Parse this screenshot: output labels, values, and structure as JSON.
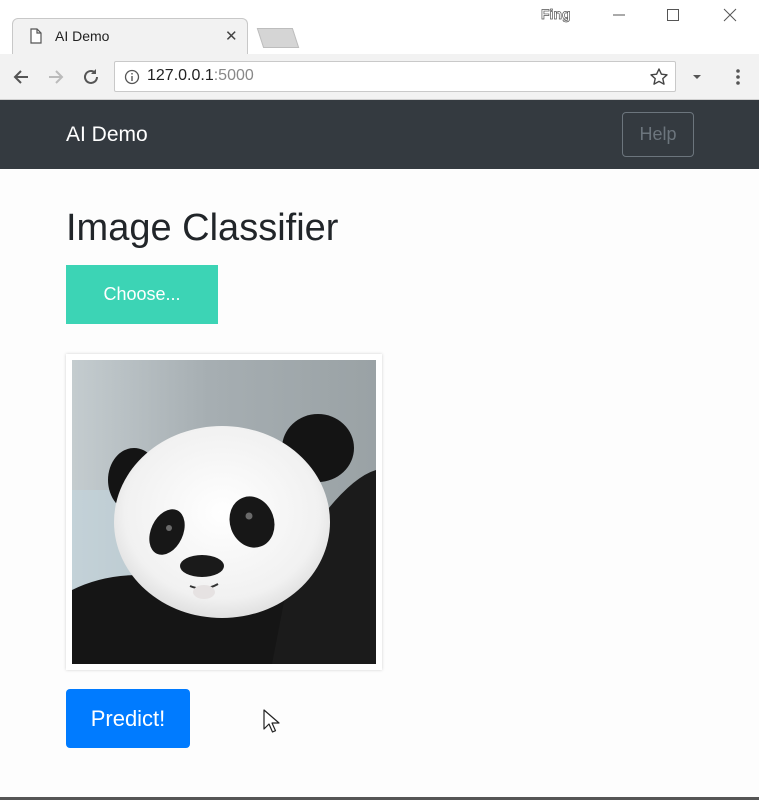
{
  "browser": {
    "tab_title": "AI Demo",
    "profile_name": "Fing",
    "url_host": "127.0.0.1",
    "url_port": ":5000"
  },
  "navbar": {
    "brand": "AI Demo",
    "help_label": "Help"
  },
  "main": {
    "title": "Image Classifier",
    "choose_label": "Choose...",
    "predict_label": "Predict!"
  },
  "colors": {
    "navbar_bg": "#343a40",
    "choose_bg": "#3cd4b5",
    "predict_bg": "#007bff"
  }
}
